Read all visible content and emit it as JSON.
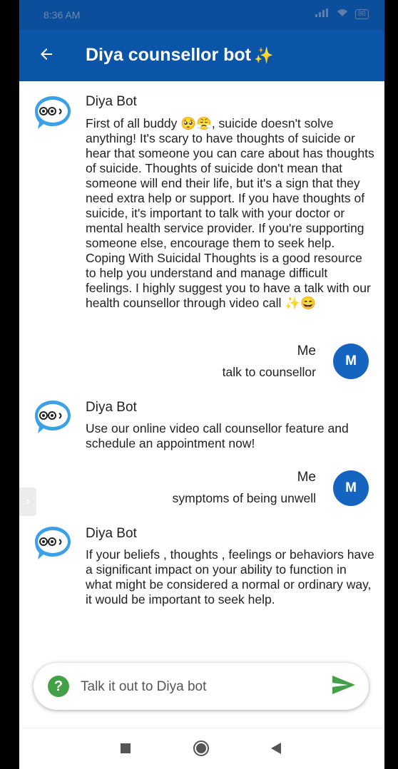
{
  "status_bar": {
    "time": "8:36 AM",
    "battery": "86"
  },
  "app_bar": {
    "title": "Diya counsellor bot",
    "title_emoji": "✨",
    "back_icon": "arrow-left-icon"
  },
  "messages": [
    {
      "sender": "Diya Bot",
      "text": "First of all buddy 🥺😤, suicide doesn't solve anything! It's scary to have thoughts of suicide or hear that someone you can care about has thoughts of suicide. Thoughts of suicide don't mean that someone will end their life, but it's a sign that they need extra help or support. If you have thoughts of suicide, it's important to talk with your doctor or mental health service provider. If you're supporting someone else, encourage them to seek help. Coping With Suicidal Thoughts is a good resource to help you understand and manage difficult feelings. I highly suggest you to have a talk with our health counsellor through video call ✨😄"
    },
    {
      "sender": "Me",
      "avatar_letter": "M",
      "text": "talk to counsellor"
    },
    {
      "sender": "Diya Bot",
      "text": "Use our online video call counsellor feature and schedule an appointment now!"
    },
    {
      "sender": "Me",
      "avatar_letter": "M",
      "text": "symptoms of being unwell"
    },
    {
      "sender": "Diya Bot",
      "text": "If your beliefs , thoughts , feelings or behaviors have a significant impact on your ability to function in what might be considered a normal or ordinary way, it would be important to seek help."
    }
  ],
  "composer": {
    "placeholder": "Talk it out to Diya bot",
    "help_icon": "question-icon",
    "help_glyph": "?",
    "send_icon": "send-icon"
  },
  "colors": {
    "app_bar": "#0b55a8",
    "status_bar": "#0b4f9c",
    "user_avatar": "#1565c0",
    "send": "#43a047"
  },
  "side_handle_glyph": "›"
}
